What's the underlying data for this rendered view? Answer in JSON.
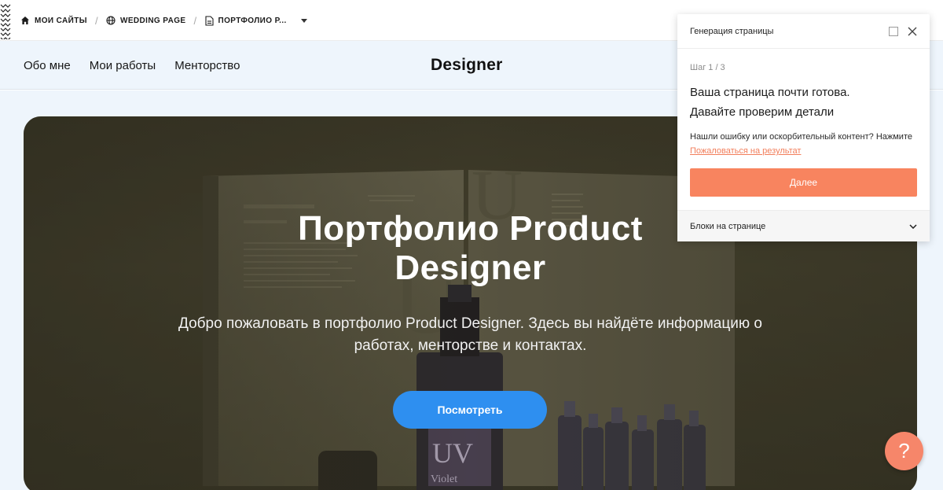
{
  "toolbar": {
    "breadcrumbs": [
      {
        "label": "МОИ САЙТЫ",
        "icon": "home-icon"
      },
      {
        "label": "WEDDING PAGE",
        "icon": "globe-icon"
      },
      {
        "label": "ПОРТФОЛИО Р...",
        "icon": "page-icon"
      }
    ],
    "separator": "/"
  },
  "site": {
    "nav": [
      "Обо мне",
      "Мои работы",
      "Менторство"
    ],
    "title": "Designer"
  },
  "hero": {
    "heading_line1": "Портфолио Product",
    "heading_line2": "Designer",
    "subtitle": "Добро пожаловать в портфолио Product Designer. Здесь вы найдёте информацию о работах, менторстве и контактах.",
    "button": "Посмотреть",
    "button_color": "#2e8ff0"
  },
  "panel": {
    "title": "Генерация страницы",
    "step": "Шаг 1 / 3",
    "ready_line1": "Ваша страница почти готова.",
    "ready_line2": "Давайте проверим детали",
    "report_text": "Нашли ошибку или оскорбительный контент? Нажмите",
    "report_link": "Пожаловаться на результат",
    "next_button": "Далее",
    "next_color": "#f8845f",
    "blocks_label": "Блоки на странице"
  },
  "help": {
    "label": "?",
    "color": "#f6866a"
  }
}
